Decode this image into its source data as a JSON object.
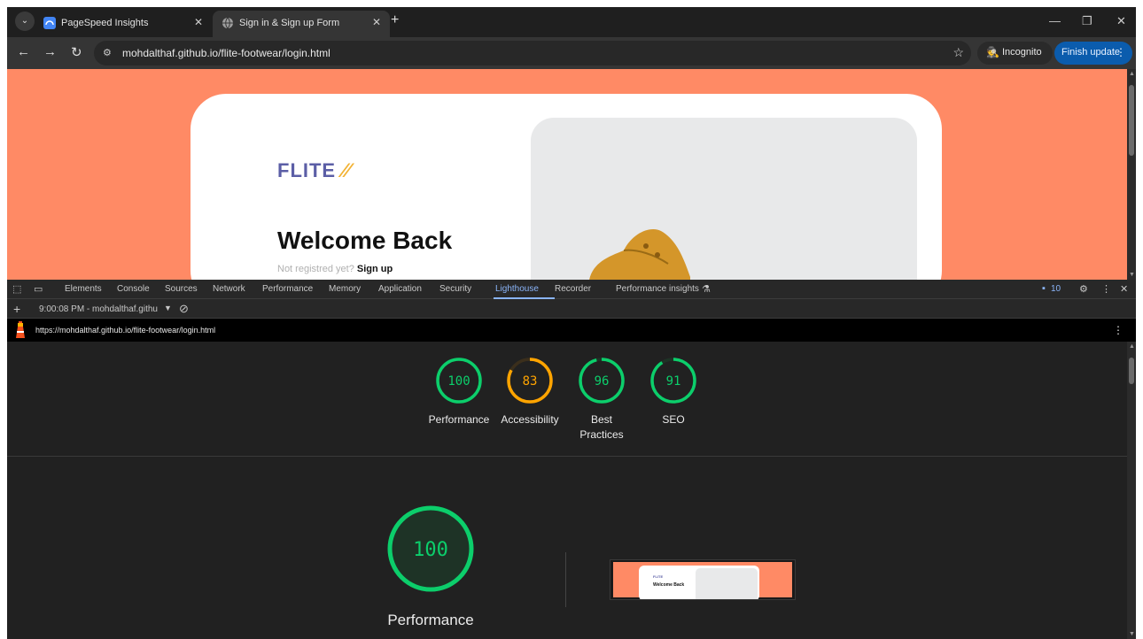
{
  "browser": {
    "tabs": [
      {
        "label": "PageSpeed Insights",
        "active": false
      },
      {
        "label": "Sign in & Sign up Form",
        "active": true
      }
    ],
    "url": "mohdalthaf.github.io/flite-footwear/login.html",
    "incognito_label": "Incognito",
    "finish_update_label": "Finish update"
  },
  "page": {
    "logo_text": "FLITE",
    "heading": "Welcome Back",
    "prompt": "Not registred yet?",
    "signup_link": "Sign up",
    "background_color": "#ff8a65"
  },
  "devtools": {
    "tabs": [
      "Elements",
      "Console",
      "Sources",
      "Network",
      "Performance",
      "Memory",
      "Application",
      "Security",
      "Lighthouse",
      "Recorder",
      "Performance insights"
    ],
    "active_tab": "Lighthouse",
    "issues_count": "10",
    "report_selector": "9:00:08 PM - mohdalthaf.githu",
    "report_url": "https://mohdalthaf.github.io/flite-footwear/login.html"
  },
  "lighthouse": {
    "scores": [
      {
        "label": "Performance",
        "score": "100",
        "value": 100,
        "color": "#0cce6b"
      },
      {
        "label": "Accessibility",
        "score": "83",
        "value": 83,
        "color": "#ffa400"
      },
      {
        "label": "Best",
        "label2": "Practices",
        "score": "96",
        "value": 96,
        "color": "#0cce6b"
      },
      {
        "label": "SEO",
        "score": "91",
        "value": 91,
        "color": "#0cce6b"
      }
    ],
    "main_score": "100",
    "main_value": 100,
    "main_label": "Performance",
    "thumb_logo": "FLITE",
    "thumb_heading": "Welcome Back"
  }
}
